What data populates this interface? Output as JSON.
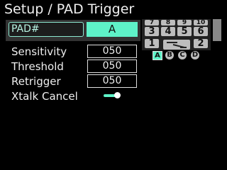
{
  "title": "Setup / PAD Trigger",
  "pad": {
    "label": "PAD#",
    "value": "A"
  },
  "params": [
    {
      "label": "Sensitivity",
      "value": "050"
    },
    {
      "label": "Threshold",
      "value": "050"
    },
    {
      "label": "Retrigger",
      "value": "050"
    }
  ],
  "xtalk": {
    "label": "Xtalk Cancel",
    "state": "on"
  },
  "pad_map": {
    "row1": [
      "7",
      "8",
      "9",
      "10"
    ],
    "row2": [
      "3",
      "4",
      "5",
      "6"
    ],
    "row3_left": "1",
    "row3_right": "2"
  },
  "selectors": [
    "A",
    "B",
    "C",
    "D"
  ],
  "selected": "A",
  "colors": {
    "accent": "#5ef2c8",
    "pad_gray": "#bdbdbd",
    "panel": "#333333"
  }
}
